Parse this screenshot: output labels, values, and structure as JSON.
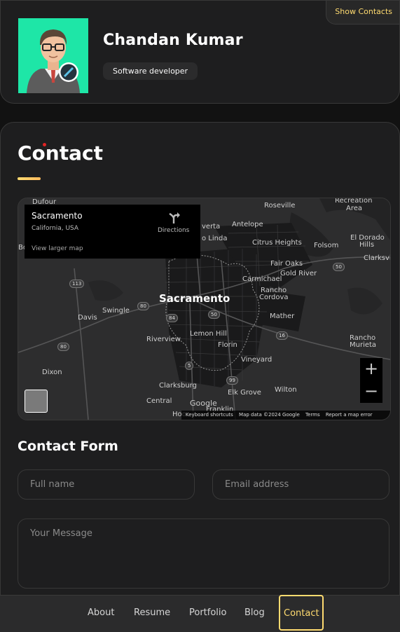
{
  "profile": {
    "name": "Chandan Kumar",
    "title": "Software developer",
    "show_contacts_label": "Show Contacts"
  },
  "page": {
    "title": "Contact"
  },
  "map": {
    "info_place": "Sacramento",
    "info_address": "California, USA",
    "info_directions": "Directions",
    "info_larger_map": "View larger map",
    "labels": {
      "dufour": "Dufour",
      "roseville": "Roseville",
      "recreation": "Recreation",
      "area": "Area",
      "verta": "verta",
      "antelope": "Antelope",
      "rio_linda": "o Linda",
      "citrus": "Citrus Heights",
      "folsom": "Folsom",
      "el_dorado": "El Dorado",
      "hills": "Hills",
      "clarksville": "Clarksvil",
      "fair_oaks": "Fair Oaks",
      "gold_river": "Gold River",
      "carmichael": "Carmichael",
      "rancho_cordova_1": "Rancho",
      "rancho_cordova_2": "Cordova",
      "sacramento": "Sacramento",
      "davis": "Davis",
      "swingle": "Swingle",
      "mather": "Mather",
      "riverview": "Riverview",
      "lemon_hill": "Lemon Hill",
      "florin": "Florin",
      "rancho_murieta_1": "Rancho",
      "rancho_murieta_2": "Murieta",
      "dixon": "Dixon",
      "vineyard": "Vineyard",
      "clarksburg": "Clarksburg",
      "elk_grove": "Elk Grove",
      "wilton": "Wilton",
      "central": "Central",
      "franklin": "Franklin",
      "hood": "Hoo",
      "bo": "Bo"
    },
    "shields": [
      "113",
      "80",
      "84",
      "50",
      "50",
      "16",
      "5",
      "99",
      "80"
    ],
    "google": "Google",
    "footer_shortcuts": "Keyboard shortcuts",
    "footer_data": "Map data ©2024 Google",
    "footer_terms": "Terms",
    "footer_report": "Report a map error",
    "zoom_in": "+",
    "zoom_out": "−"
  },
  "form": {
    "title": "Contact Form",
    "fullname_placeholder": "Full name",
    "email_placeholder": "Email address",
    "message_placeholder": "Your Message"
  },
  "nav": {
    "items": [
      {
        "label": "About"
      },
      {
        "label": "Resume"
      },
      {
        "label": "Portfolio"
      },
      {
        "label": "Blog"
      },
      {
        "label": "Contact"
      }
    ]
  },
  "colors": {
    "accent": "#ffdb70",
    "avatar_bg": "#1ee6a7",
    "card_bg": "#1e1e1f"
  }
}
